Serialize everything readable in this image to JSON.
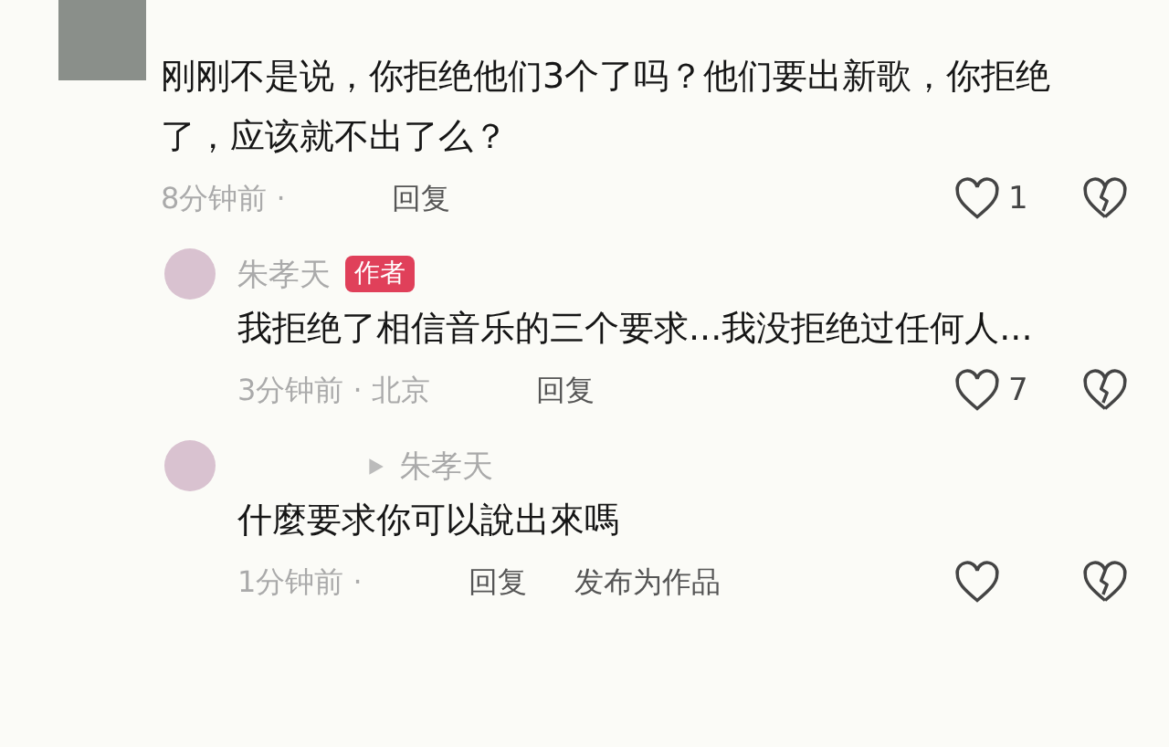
{
  "comments": [
    {
      "text": "刚刚不是说，你拒绝他们3个了吗？他们要出新歌，你拒绝了，应该就不出了么？",
      "time": "8分钟前 ·",
      "reply": "回复",
      "likes": "1",
      "liked": false,
      "children": [
        {
          "author": "朱孝天",
          "badge": "作者",
          "text": "我拒绝了相信音乐的三个要求...我没拒绝过任何人...",
          "time": "3分钟前 · 北京",
          "reply": "回复",
          "likes": "7",
          "liked": false
        },
        {
          "reply_to": "朱孝天",
          "text": "什麼要求你可以說出來嗎",
          "time": "1分钟前 ·",
          "reply": "回复",
          "extra_action": "发布为作品",
          "liked": false
        }
      ]
    }
  ]
}
